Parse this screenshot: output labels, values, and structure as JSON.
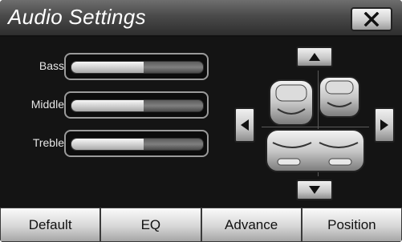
{
  "window": {
    "title": "Audio Settings",
    "close_icon": "close-icon"
  },
  "sliders": [
    {
      "label": "Bass",
      "level": 0.55
    },
    {
      "label": "Middle",
      "level": 0.55
    },
    {
      "label": "Treble",
      "level": 0.55
    }
  ],
  "position_panel": {
    "up_icon": "arrow-up-icon",
    "down_icon": "arrow-down-icon",
    "left_icon": "arrow-left-icon",
    "right_icon": "arrow-right-icon",
    "seats": [
      "front-left-seat",
      "front-right-seat",
      "rear-seat"
    ]
  },
  "tabs": [
    "Default",
    "EQ",
    "Advance",
    "Position"
  ]
}
